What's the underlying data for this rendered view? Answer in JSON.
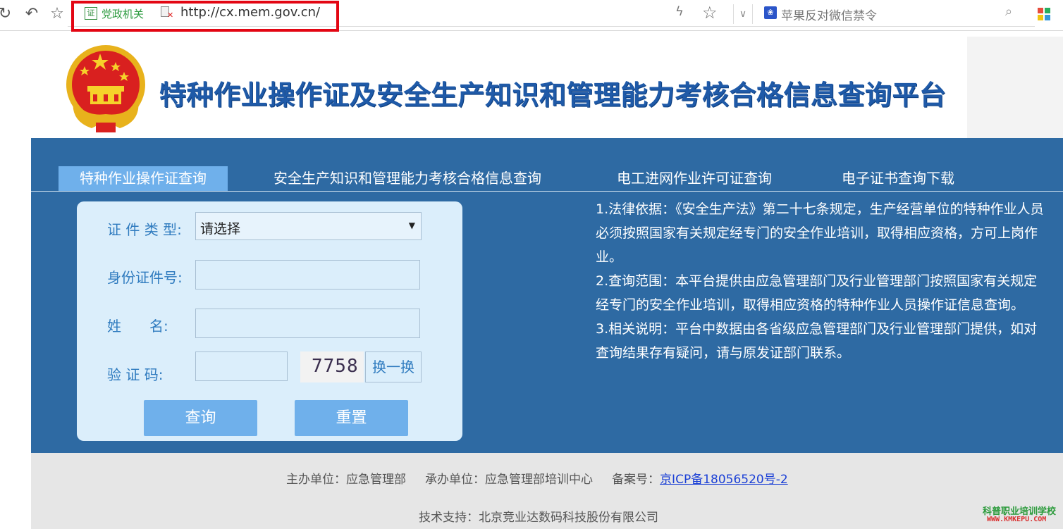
{
  "browser": {
    "security_badge": "证",
    "security_label": "党政机关",
    "url": "http://cx.mem.gov.cn/",
    "search_placeholder": "苹果反对微信禁令"
  },
  "header": {
    "title": "特种作业操作证及安全生产知识和管理能力考核合格信息查询平台"
  },
  "tabs": [
    {
      "label": "特种作业操作证查询",
      "active": true
    },
    {
      "label": "安全生产知识和管理能力考核合格信息查询",
      "active": false
    },
    {
      "label": "电工进网作业许可证查询",
      "active": false
    },
    {
      "label": "电子证书查询下载",
      "active": false
    }
  ],
  "form": {
    "cert_type_label": "证 件 类 型:",
    "cert_type_value": "请选择",
    "id_label": "身份证件号:",
    "id_value": "",
    "name_label": "姓　　名:",
    "name_value": "",
    "captcha_label": "验 证 码:",
    "captcha_value": "",
    "captcha_image_text": "7758",
    "refresh_label": "换一换",
    "query_label": "查询",
    "reset_label": "重置"
  },
  "info": [
    "1.法律依据：《安全生产法》第二十七条规定，生产经营单位的特种作业人员必须按照国家有关规定经专门的安全作业培训，取得相应资格，方可上岗作业。",
    "2.查询范围：本平台提供由应急管理部门及行业管理部门按照国家有关规定经专门的安全作业培训，取得相应资格的特种作业人员操作证信息查询。",
    "3.相关说明：平台中数据由各省级应急管理部门及行业管理部门提供，如对查询结果存有疑问，请与原发证部门联系。"
  ],
  "footer": {
    "sponsor": "主办单位：应急管理部",
    "organizer": "承办单位：应急管理部培训中心",
    "icp_label": "备案号：",
    "icp_link": "京ICP备18056520号-2",
    "tech_support": "技术支持：北京竞业达数码科技股份有限公司"
  },
  "watermark": {
    "school": "科普职业培训学校",
    "site": "WWW.KMKEPU.COM"
  },
  "colors": {
    "brand_blue": "#2e6aa3",
    "tab_active": "#6fb0eb",
    "card_bg": "#dbeefb",
    "label_blue": "#2f7bbf",
    "url_highlight": "#e30613"
  }
}
